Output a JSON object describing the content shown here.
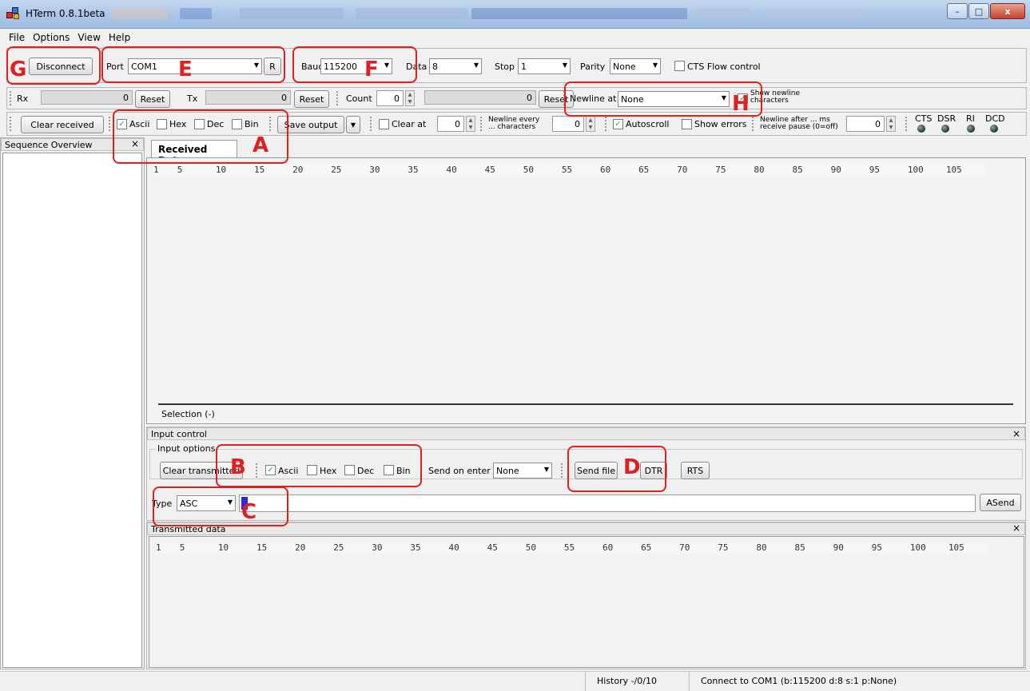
{
  "window": {
    "title": "HTerm 0.8.1beta",
    "controls": {
      "minimize": "–",
      "maximize": "□",
      "close": "x"
    }
  },
  "menu": [
    "File",
    "Options",
    "View",
    "Help"
  ],
  "connection": {
    "disconnect": "Disconnect",
    "port_label": "Port",
    "port_value": "COM1",
    "refresh": "R",
    "baud_label": "Baud",
    "baud_value": "115200",
    "data_label": "Data",
    "data_value": "8",
    "stop_label": "Stop",
    "stop_value": "1",
    "parity_label": "Parity",
    "parity_value": "None",
    "cts_flow": "CTS Flow control"
  },
  "counters": {
    "rx_label": "Rx",
    "rx_value": "0",
    "reset": "Reset",
    "tx_label": "Tx",
    "tx_value": "0",
    "count_label": "Count",
    "count_value": "0",
    "count_progress": "0",
    "newline_label": "Newline at",
    "newline_value": "None",
    "show_newline": "Show newline characters"
  },
  "display": {
    "clear_received": "Clear received",
    "ascii": "Ascii",
    "hex": "Hex",
    "dec": "Dec",
    "bin": "Bin",
    "save_output": "Save output",
    "clear_at": "Clear at",
    "clear_at_value": "0",
    "newline_every": "Newline every ... characters",
    "newline_every_value": "0",
    "autoscroll": "Autoscroll",
    "show_errors": "Show errors",
    "newline_after": "Newline after ... ms receive pause (0=off)",
    "newline_after_value": "0",
    "signals": [
      "CTS",
      "DSR",
      "RI",
      "DCD"
    ]
  },
  "sequence": {
    "title": "Sequence Overview",
    "close": "×"
  },
  "received": {
    "tab": "Received Data",
    "ruler": [
      "1",
      "5",
      "10",
      "15",
      "20",
      "25",
      "30",
      "35",
      "40",
      "45",
      "50",
      "55",
      "60",
      "65",
      "70",
      "75",
      "80",
      "85",
      "90",
      "95",
      "100",
      "105"
    ],
    "selection": "Selection (-)"
  },
  "input": {
    "title": "Input control",
    "close": "×",
    "options_label": "Input options",
    "clear_transmitted": "Clear transmitted",
    "ascii": "Ascii",
    "hex": "Hex",
    "dec": "Dec",
    "bin": "Bin",
    "send_on_enter": "Send on enter",
    "send_on_enter_value": "None",
    "send_file": "Send file",
    "dtr": "DTR",
    "rts": "RTS",
    "type_label": "Type",
    "type_value": "ASC",
    "asend": "ASend"
  },
  "transmitted": {
    "title": "Transmitted data",
    "close": "×",
    "ruler": [
      "1",
      "5",
      "10",
      "15",
      "20",
      "25",
      "30",
      "35",
      "40",
      "45",
      "50",
      "55",
      "60",
      "65",
      "70",
      "75",
      "80",
      "85",
      "90",
      "95",
      "100",
      "105"
    ]
  },
  "status": {
    "history": "History -/0/10",
    "connection": "Connect to COM1 (b:115200 d:8 s:1 p:None)"
  },
  "annotations": [
    "A",
    "B",
    "C",
    "D",
    "E",
    "F",
    "G",
    "H"
  ],
  "colors": {
    "annotation": "#e02020",
    "titlebar": "#a9c4e6",
    "cursor": "#2a2adf"
  }
}
